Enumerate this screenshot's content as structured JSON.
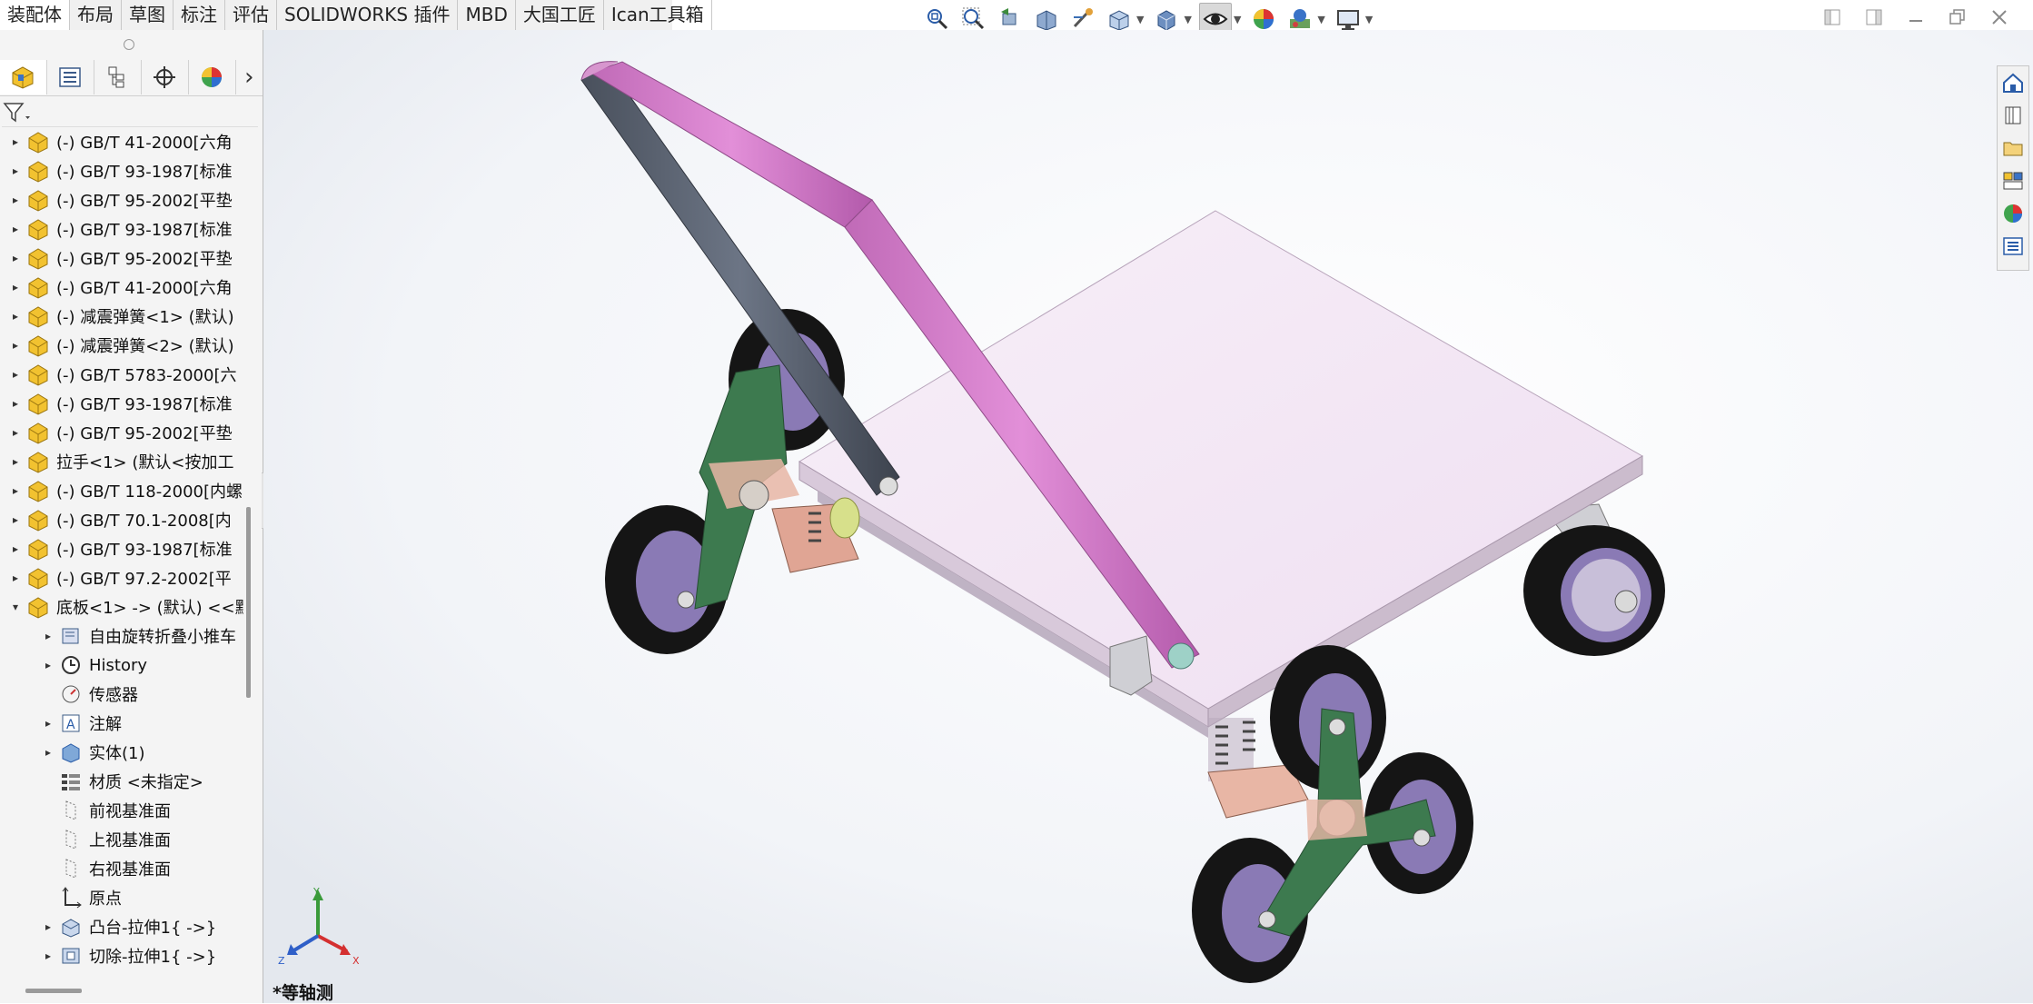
{
  "tabs": [
    "装配体",
    "布局",
    "草图",
    "标注",
    "评估",
    "SOLIDWORKS 插件",
    "MBD",
    "大国工匠",
    "Ican工具箱"
  ],
  "active_tab": 0,
  "view_toolbar": [
    "zoom-to-fit-icon",
    "zoom-to-area-icon",
    "previous-view-icon",
    "section-view-icon",
    "dynamic-annotation-icon",
    "view-orientation-icon",
    "display-style-icon",
    "hide-show-items-icon",
    "edit-appearance-icon",
    "apply-scene-icon",
    "view-settings-icon"
  ],
  "feature_tree": {
    "items": [
      {
        "label": "(-) GB/T 41-2000[六角",
        "kind": "part",
        "level": 0,
        "expandable": true
      },
      {
        "label": "(-) GB/T 93-1987[标准",
        "kind": "part",
        "level": 0,
        "expandable": true
      },
      {
        "label": "(-) GB/T 95-2002[平垫",
        "kind": "part",
        "level": 0,
        "expandable": true
      },
      {
        "label": "(-) GB/T 93-1987[标准",
        "kind": "part",
        "level": 0,
        "expandable": true
      },
      {
        "label": "(-) GB/T 95-2002[平垫",
        "kind": "part",
        "level": 0,
        "expandable": true
      },
      {
        "label": "(-) GB/T 41-2000[六角",
        "kind": "part",
        "level": 0,
        "expandable": true
      },
      {
        "label": "(-) 减震弹簧<1> (默认)",
        "kind": "part",
        "level": 0,
        "expandable": true
      },
      {
        "label": "(-) 减震弹簧<2> (默认)",
        "kind": "part",
        "level": 0,
        "expandable": true
      },
      {
        "label": "(-) GB/T 5783-2000[六",
        "kind": "part",
        "level": 0,
        "expandable": true
      },
      {
        "label": "(-) GB/T 93-1987[标准",
        "kind": "part",
        "level": 0,
        "expandable": true
      },
      {
        "label": "(-) GB/T 95-2002[平垫",
        "kind": "part",
        "level": 0,
        "expandable": true
      },
      {
        "label": "拉手<1> (默认<按加工",
        "kind": "part",
        "level": 0,
        "expandable": true
      },
      {
        "label": "(-) GB/T 118-2000[内螺",
        "kind": "part",
        "level": 0,
        "expandable": true
      },
      {
        "label": "(-) GB/T 70.1-2008[内",
        "kind": "part",
        "level": 0,
        "expandable": true
      },
      {
        "label": "(-) GB/T 93-1987[标准",
        "kind": "part",
        "level": 0,
        "expandable": true
      },
      {
        "label": "(-) GB/T 97.2-2002[平",
        "kind": "part",
        "level": 0,
        "expandable": true
      },
      {
        "label": "底板<1> -> (默认) <<默",
        "kind": "part",
        "level": 0,
        "expandable": true,
        "expanded": true
      },
      {
        "label": "自由旋转折叠小推车",
        "kind": "assembly",
        "level": 1,
        "expandable": true
      },
      {
        "label": "History",
        "kind": "history",
        "level": 1,
        "expandable": true
      },
      {
        "label": "传感器",
        "kind": "sensor",
        "level": 1,
        "expandable": false
      },
      {
        "label": "注解",
        "kind": "annotation",
        "level": 1,
        "expandable": true
      },
      {
        "label": "实体(1)",
        "kind": "solid",
        "level": 1,
        "expandable": true
      },
      {
        "label": "材质 <未指定>",
        "kind": "material",
        "level": 1,
        "expandable": false
      },
      {
        "label": "前视基准面",
        "kind": "plane",
        "level": 1,
        "expandable": false
      },
      {
        "label": "上视基准面",
        "kind": "plane",
        "level": 1,
        "expandable": false
      },
      {
        "label": "右视基准面",
        "kind": "plane",
        "level": 1,
        "expandable": false
      },
      {
        "label": "原点",
        "kind": "origin",
        "level": 1,
        "expandable": false
      },
      {
        "label": "凸台-拉伸1{ ->}",
        "kind": "extrude",
        "level": 1,
        "expandable": true
      },
      {
        "label": "切除-拉伸1{ ->}",
        "kind": "cut",
        "level": 1,
        "expandable": true
      }
    ]
  },
  "viewport": {
    "view_name": "*等轴测",
    "axis_labels": {
      "x": "X",
      "y": "Y",
      "z": "Z"
    }
  },
  "task_pane": [
    "home-icon",
    "design-library-icon",
    "file-explorer-icon",
    "view-palette-icon",
    "appearances-icon",
    "custom-properties-icon"
  ],
  "colors": {
    "platform": "#f2e6f3",
    "handle_pink": "#d278c8",
    "handle_grey": "#5d6675",
    "bracket_green": "#3d7a4f",
    "tire": "#151515",
    "hub": "#8a7ab5"
  }
}
